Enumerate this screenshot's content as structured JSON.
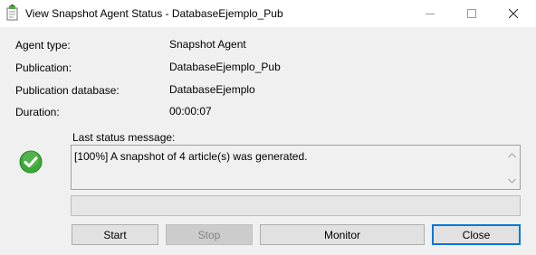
{
  "window": {
    "title": "View Snapshot Agent Status - DatabaseEjemplo_Pub",
    "icon": "replication-agent-icon",
    "controls": [
      "minimize-icon",
      "maximize-icon",
      "close-icon"
    ]
  },
  "details": {
    "agent_type_label": "Agent type:",
    "agent_type_value": "Snapshot Agent",
    "publication_label": "Publication:",
    "publication_value": "DatabaseEjemplo_Pub",
    "publication_db_label": "Publication database:",
    "publication_db_value": "DatabaseEjemplo",
    "duration_label": "Duration:",
    "duration_value": "00:00:07"
  },
  "status": {
    "label": "Last status message:",
    "icon": "success-check-icon",
    "message": "[100%] A snapshot of 4 article(s) was generated."
  },
  "progress": {
    "value": 0
  },
  "buttons": {
    "start": "Start",
    "stop": "Stop",
    "monitor": "Monitor",
    "close": "Close"
  },
  "colors": {
    "success": "#3aa935",
    "default_button_border": "#0078d7",
    "progress_fill": "#06b025"
  }
}
